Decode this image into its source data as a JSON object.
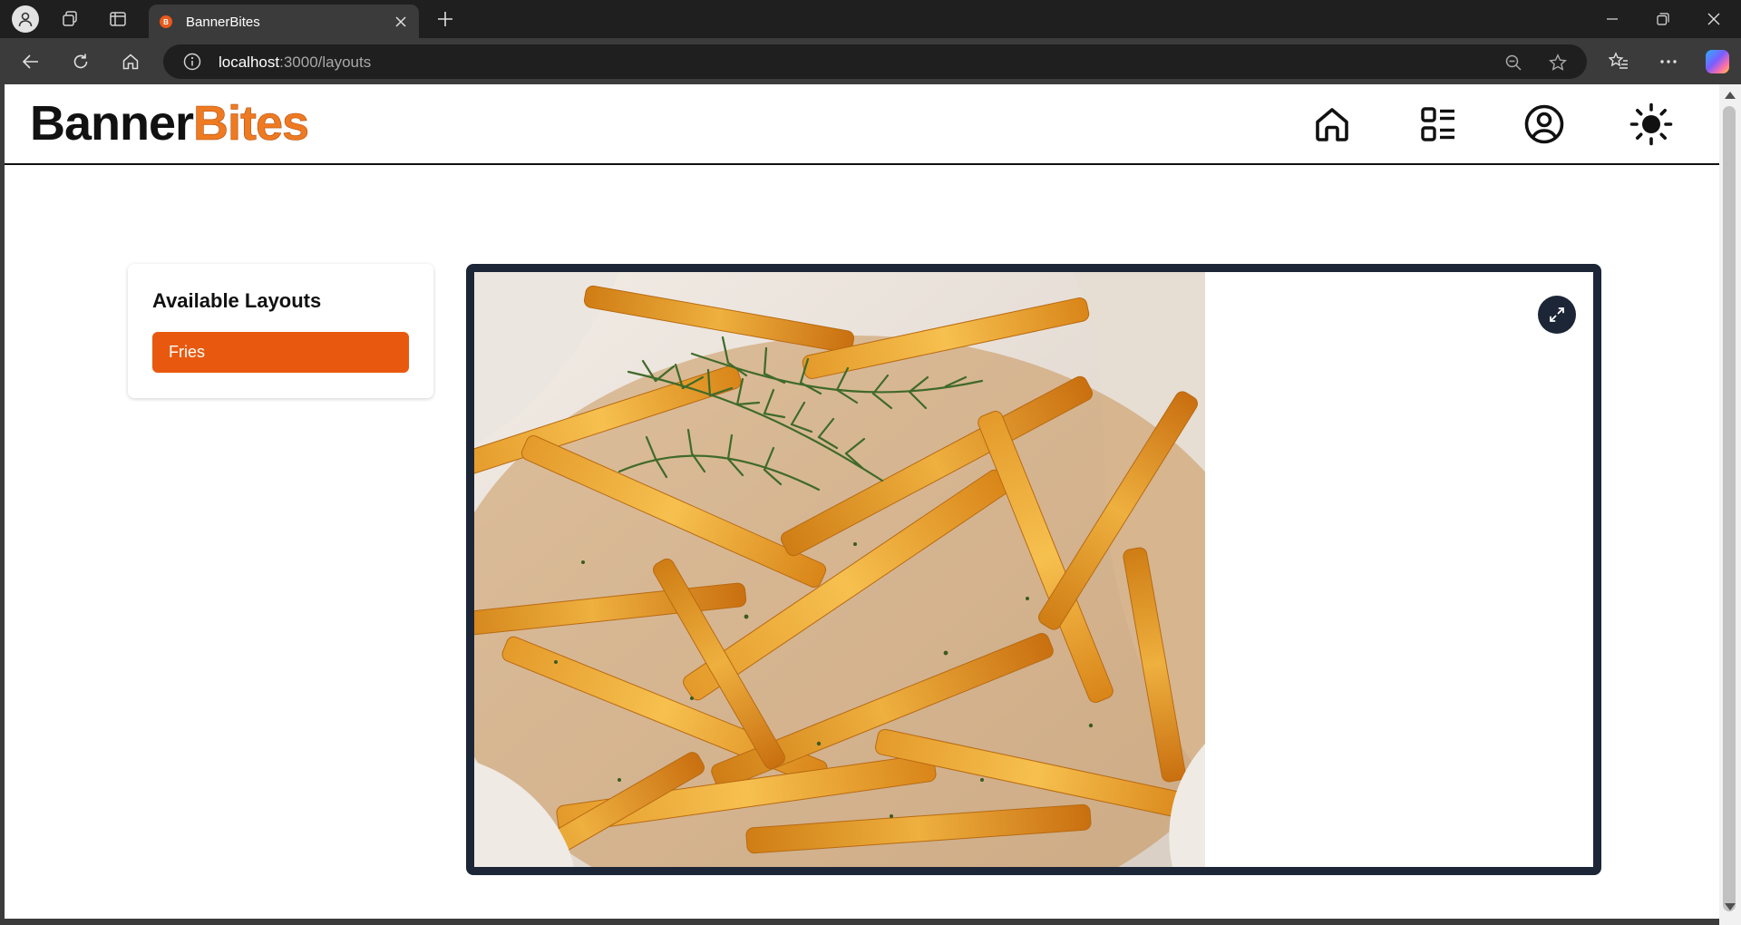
{
  "browser": {
    "tab_title": "BannerBites",
    "url_host": "localhost",
    "url_path": ":3000/layouts"
  },
  "app": {
    "brand_part1": "Banner",
    "brand_part2": "Bites",
    "nav_icons": [
      "home-icon",
      "layout-list-icon",
      "user-circle-icon",
      "sun-icon"
    ]
  },
  "sidebar": {
    "title": "Available Layouts",
    "items": [
      {
        "label": "Fries",
        "selected": true
      }
    ]
  },
  "preview": {
    "image_subject": "french fries with rosemary",
    "expand_icon": "expand-arrows-icon"
  },
  "colors": {
    "accent": "#e8590f",
    "brand_orange": "#ee7a22",
    "frame": "#1c2636"
  }
}
